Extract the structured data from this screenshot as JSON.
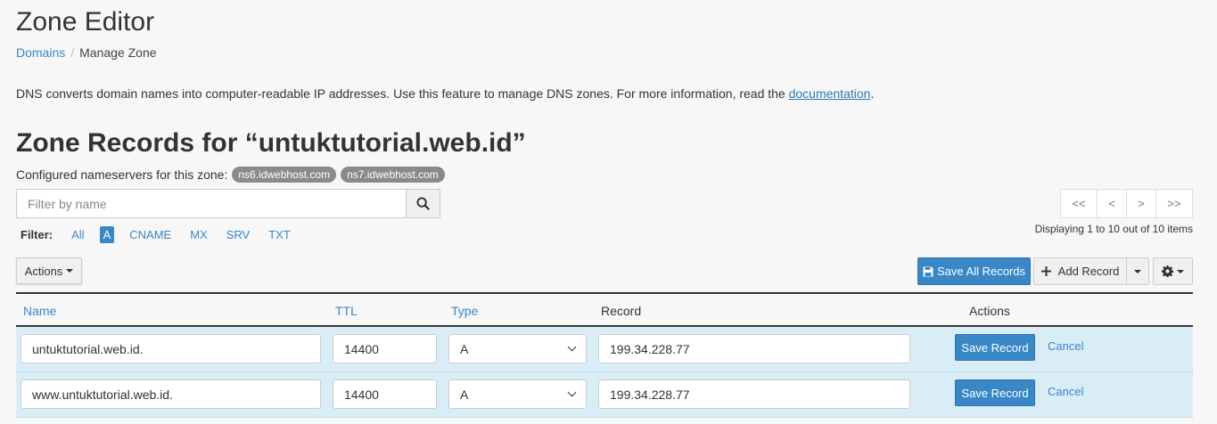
{
  "header": {
    "title": "Zone Editor",
    "breadcrumb": {
      "link": "Domains",
      "separator": "/",
      "current": "Manage Zone"
    }
  },
  "intro": {
    "text": "DNS converts domain names into computer-readable IP addresses. Use this feature to manage DNS zones. For more information, read the ",
    "link": "documentation",
    "suffix": "."
  },
  "zone": {
    "title": "Zone Records for “untuktutorial.web.id”",
    "ns_label": "Configured nameservers for this zone:",
    "nameservers": [
      "ns6.idwebhost.com",
      "ns7.idwebhost.com"
    ]
  },
  "search": {
    "placeholder": "Filter by name",
    "icon": "search-icon"
  },
  "filter": {
    "label": "Filter:",
    "options": [
      "All",
      "A",
      "CNAME",
      "MX",
      "SRV",
      "TXT"
    ],
    "active": "A"
  },
  "pagination": {
    "buttons": [
      "<<",
      "<",
      ">",
      ">>"
    ],
    "status": "Displaying 1 to 10 out of 10 items"
  },
  "toolbar": {
    "actions_label": "Actions",
    "save_all_label": "Save All Records",
    "save_all_icon": "floppy-icon",
    "add_record_label": "Add Record",
    "add_record_icon": "plus-icon",
    "settings_icon": "gear-icon"
  },
  "table": {
    "headers": {
      "name": "Name",
      "ttl": "TTL",
      "type": "Type",
      "record": "Record",
      "actions": "Actions"
    },
    "rows": [
      {
        "name": "untuktutorial.web.id.",
        "ttl": "14400",
        "type": "A",
        "record": "199.34.228.77",
        "save": "Save Record",
        "cancel": "Cancel"
      },
      {
        "name": "www.untuktutorial.web.id.",
        "ttl": "14400",
        "type": "A",
        "record": "199.34.228.77",
        "save": "Save Record",
        "cancel": "Cancel"
      }
    ]
  },
  "colors": {
    "accent": "#3a87c8",
    "row_highlight": "#d9edf7",
    "badge": "#8a8a8a"
  }
}
